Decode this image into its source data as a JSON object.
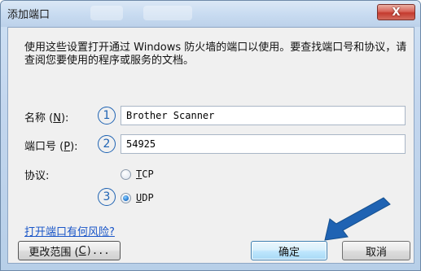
{
  "window": {
    "title": "添加端口",
    "close_label": "X"
  },
  "dialog": {
    "description": "使用这些设置打开通过 Windows 防火墙的端口以使用。要查找端口号和协议，请查阅您要使用的程序或服务的文档。",
    "name": {
      "label_prefix": "名称 (",
      "label_key": "N",
      "label_suffix": "):",
      "step": "1",
      "value": "Brother Scanner"
    },
    "port": {
      "label_prefix": "端口号 (",
      "label_key": "P",
      "label_suffix": "):",
      "step": "2",
      "value": "54925"
    },
    "protocol": {
      "label": "协议:",
      "tcp_key": "T",
      "tcp_rest": "CP",
      "udp_key": "U",
      "udp_rest": "DP",
      "selected": "UDP",
      "step": "3"
    },
    "link_text": "打开端口有何风险?",
    "buttons": {
      "change_scope_prefix": "更改范围 (",
      "change_scope_key": "C",
      "change_scope_suffix": ")...",
      "ok": "确定",
      "cancel": "取消"
    }
  },
  "colors": {
    "accent_blue": "#1f63b3",
    "link": "#1a56c8"
  }
}
